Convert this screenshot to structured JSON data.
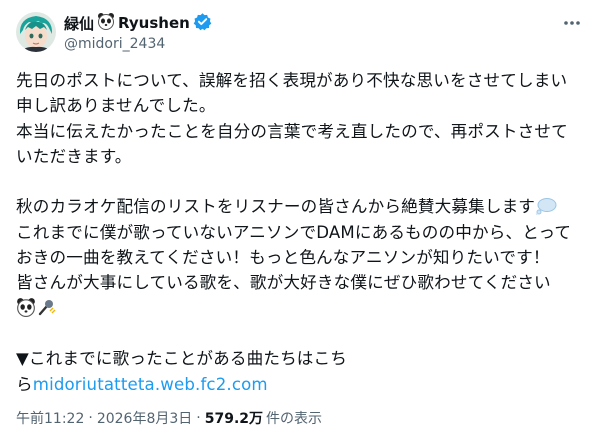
{
  "author": {
    "name": "緑仙",
    "name_suffix": "Ryushen",
    "handle": "@midori_2434",
    "avatar_icon": "avatar-image",
    "verified_icon": "verified-badge-icon",
    "verified_color": "#1d9bf0"
  },
  "post": {
    "lines": [
      "先日のポストについて、誤解を招く表現があり不快な思いをさせてしまい",
      "申し訳ありませんでした。",
      "本当に伝えたかったことを自分の言葉で考え直したので、再ポストさせて",
      "いただきます。",
      "",
      "秋のカラオケ配信のリストをリスナーの皆さんから絶賛大募集します",
      "これまでに僕が歌っていないアニソンでDAMにあるものの中から、とって",
      "おきの一曲を教えてください！もっと色んなアニソンが知りたいです！",
      "皆さんが大事にしている歌を、歌が大好きな僕にぜひ歌わせてください",
      "",
      "",
      "▼これまでに歌ったことがある曲たちはこち",
      "ら"
    ],
    "link_text": "midoriutatteta.web.fc2.com",
    "link_color": "#1d9bf0",
    "emoji_icons": [
      "speech-balloon-icon",
      "panda-icon",
      "microphone-icon"
    ]
  },
  "meta": {
    "time": "午前11:22",
    "separator": "·",
    "date": "2026年8月3日",
    "views_count": "579.2万",
    "views_label": "件の表示"
  }
}
